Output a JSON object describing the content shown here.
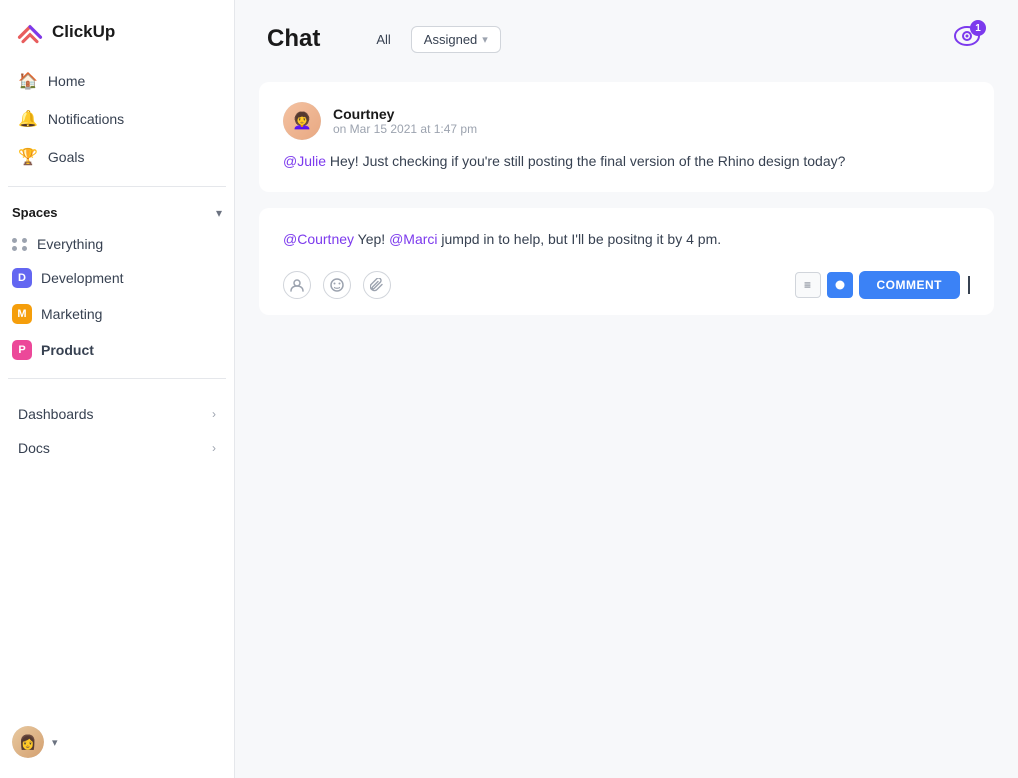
{
  "app": {
    "logo_text": "ClickUp"
  },
  "sidebar": {
    "nav_items": [
      {
        "id": "home",
        "label": "Home",
        "icon": "🏠"
      },
      {
        "id": "notifications",
        "label": "Notifications",
        "icon": "🔔"
      },
      {
        "id": "goals",
        "label": "Goals",
        "icon": "🏆"
      }
    ],
    "spaces_label": "Spaces",
    "spaces": [
      {
        "id": "everything",
        "label": "Everything",
        "type": "grid"
      },
      {
        "id": "development",
        "label": "Development",
        "type": "badge",
        "color": "#6366f1",
        "letter": "D"
      },
      {
        "id": "marketing",
        "label": "Marketing",
        "type": "badge",
        "color": "#f59e0b",
        "letter": "M"
      },
      {
        "id": "product",
        "label": "Product",
        "type": "badge",
        "color": "#ec4899",
        "letter": "P",
        "active": true
      }
    ],
    "sections": [
      {
        "id": "dashboards",
        "label": "Dashboards"
      },
      {
        "id": "docs",
        "label": "Docs"
      }
    ]
  },
  "chat": {
    "title": "Chat",
    "filter_all": "All",
    "filter_assigned": "Assigned",
    "watch_count": "1",
    "messages": [
      {
        "id": "msg1",
        "author": "Courtney",
        "time": "on Mar 15 2021 at 1:47 pm",
        "mention": "@Julie",
        "text": " Hey! Just checking if you're still posting the final version of the Rhino design today?"
      }
    ],
    "reply": {
      "mention1": "@Courtney",
      "text1": " Yep! ",
      "mention2": "@Marci",
      "text2": " jumpd in to help, but I'll be positng it by 4 pm."
    },
    "comment_button": "COMMENT",
    "format_icons": [
      "≡",
      "●"
    ]
  }
}
